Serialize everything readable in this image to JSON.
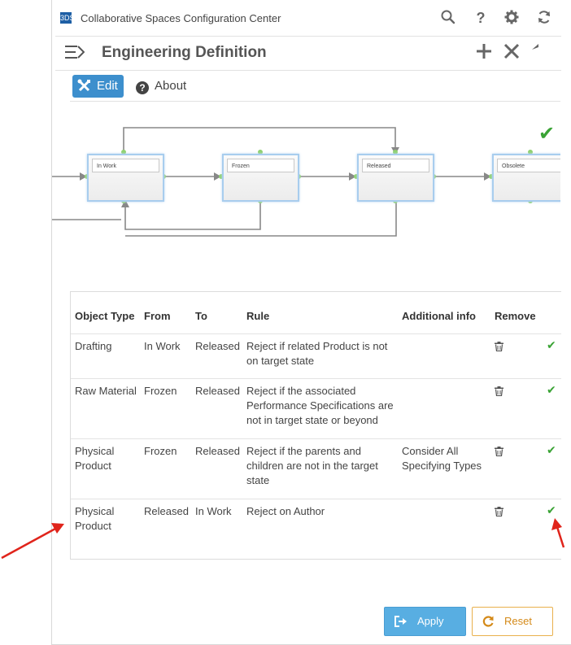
{
  "app": {
    "title": "Collaborative Spaces Configuration Center",
    "logo_text": "3DS",
    "toolbar_icons": [
      "search-icon",
      "help-icon",
      "gear-icon",
      "refresh-icon"
    ]
  },
  "header": {
    "title": "Engineering Definition",
    "actions": [
      "add-icon",
      "close-icon",
      "back-icon"
    ]
  },
  "tabs": [
    {
      "label": "Edit",
      "active": true,
      "icon": "tools-icon"
    },
    {
      "label": "About",
      "active": false,
      "icon": "help-circle-icon"
    }
  ],
  "diagram": {
    "states": [
      "In Work",
      "Frozen",
      "Released",
      "Obsolete"
    ],
    "status_icon": "checkmark-icon",
    "status_color": "#3aa335"
  },
  "table": {
    "headers": [
      "Object Type",
      "From",
      "To",
      "Rule",
      "Additional info",
      "Remove"
    ],
    "rows": [
      {
        "object_type": "Drafting",
        "from": "In Work",
        "to": "Released",
        "rule": "Reject if related Product is not on target state",
        "additional": ""
      },
      {
        "object_type": "Raw Material",
        "from": "Frozen",
        "to": "Released",
        "rule": "Reject if the associated Performance Specifications are not in target state or beyond",
        "additional": ""
      },
      {
        "object_type": "Physical Product",
        "from": "Frozen",
        "to": "Released",
        "rule": "Reject if the parents and children are not in the target state",
        "additional": "Consider All Specifying Types"
      },
      {
        "object_type": "Physical Product",
        "from": "Released",
        "to": "In Work",
        "rule": "Reject on Author",
        "additional": ""
      }
    ]
  },
  "footer": {
    "apply_label": "Apply",
    "reset_label": "Reset"
  },
  "colors": {
    "accent": "#3d8fcd",
    "apply": "#58aee2",
    "reset": "#d48a19",
    "check": "#3aa335",
    "annotation": "#e0241b"
  }
}
